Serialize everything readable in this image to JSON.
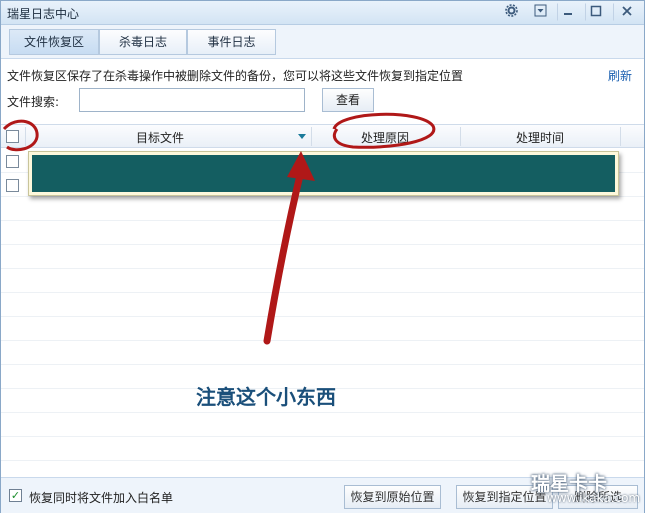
{
  "window": {
    "title": "瑞星日志中心"
  },
  "tabs": [
    {
      "label": "文件恢复区"
    },
    {
      "label": "杀毒日志"
    },
    {
      "label": "事件日志"
    }
  ],
  "info": {
    "description": "文件恢复区保存了在杀毒操作中被删除文件的备份，您可以将这些文件恢复到指定位置",
    "refresh_label": "刷新"
  },
  "search": {
    "label": "文件搜索:",
    "value": "",
    "button_label": "查看"
  },
  "table": {
    "columns": [
      "目标文件",
      "处理原因",
      "处理时间"
    ]
  },
  "footer": {
    "whitelist_checked": true,
    "whitelist_label": "恢复同时将文件加入白名单",
    "restore_original_label": "恢复到原始位置",
    "restore_custom_label": "恢复到指定位置",
    "third_button_label": "删除所选"
  },
  "annotation": {
    "text": "注意这个小东西",
    "color": "#b01818"
  },
  "watermark": {
    "brand": "瑞星卡卡",
    "url": "www.ikaka.com"
  },
  "colors": {
    "accent_link": "#1a5fb0",
    "popup_fill": "#145e61",
    "annotation_red": "#b01818"
  }
}
